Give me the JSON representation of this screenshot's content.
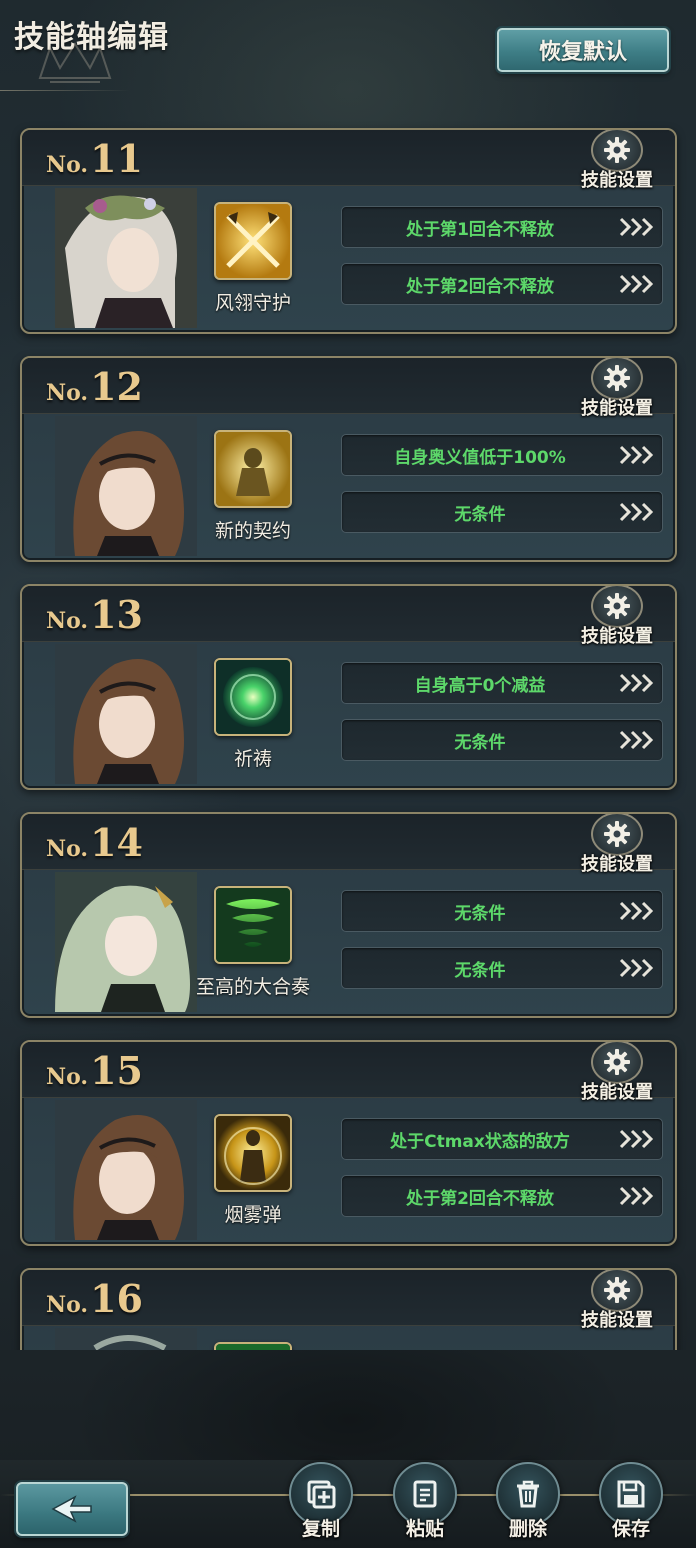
{
  "header": {
    "title": "技能轴编辑",
    "reset_label": "恢复默认"
  },
  "settings_label": "技能设置",
  "no_prefix": "No.",
  "cards": [
    {
      "no": "11",
      "skill_name": "风翎守护",
      "skill_icon": "crossed-swords-icon",
      "portrait": "elf-heroine-portrait",
      "conditions": [
        "处于第1回合不释放",
        "处于第2回合不释放"
      ]
    },
    {
      "no": "12",
      "skill_name": "新的契约",
      "skill_icon": "golden-knight-icon",
      "portrait": "brown-hair-heroine-portrait",
      "conditions": [
        "自身奥义值低于100%",
        "无条件"
      ]
    },
    {
      "no": "13",
      "skill_name": "祈祷",
      "skill_icon": "green-orb-icon",
      "portrait": "brown-hair-heroine-portrait",
      "conditions": [
        "自身高于0个减益",
        "无条件"
      ]
    },
    {
      "no": "14",
      "skill_name": "至高的大合奏",
      "skill_icon": "green-tornado-icon",
      "portrait": "green-hair-heroine-portrait",
      "conditions": [
        "无条件",
        "无条件"
      ]
    },
    {
      "no": "15",
      "skill_name": "烟雾弹",
      "skill_icon": "golden-aura-icon",
      "portrait": "brown-hair-heroine-portrait",
      "conditions": [
        "处于Ctmax状态的敌方",
        "处于第2回合不释放"
      ]
    },
    {
      "no": "16",
      "skill_name": "",
      "skill_icon": "green-skill-icon",
      "portrait": "partial-portrait",
      "conditions": []
    }
  ],
  "toolbar": {
    "copy_label": "复制",
    "paste_label": "粘贴",
    "delete_label": "删除",
    "save_label": "保存"
  },
  "colors": {
    "condition_text": "#5dd86a",
    "number_gold": "#e8c98e",
    "accent_teal": "#3e7e86"
  }
}
